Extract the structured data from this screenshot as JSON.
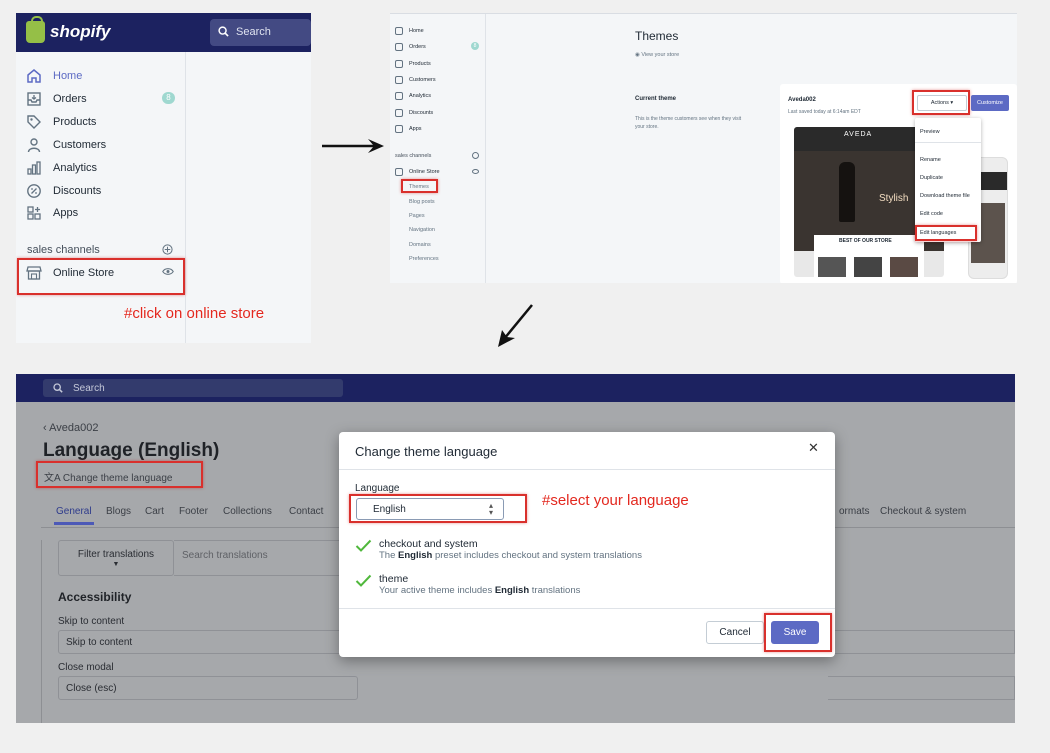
{
  "panel1": {
    "brand": "shopify",
    "search_placeholder": "Search",
    "nav": [
      {
        "label": "Home",
        "icon": "home-icon",
        "active": true
      },
      {
        "label": "Orders",
        "icon": "orders-icon",
        "badge": "8"
      },
      {
        "label": "Products",
        "icon": "tag-icon"
      },
      {
        "label": "Customers",
        "icon": "person-icon"
      },
      {
        "label": "Analytics",
        "icon": "bar-chart-icon"
      },
      {
        "label": "Discounts",
        "icon": "discount-icon"
      },
      {
        "label": "Apps",
        "icon": "apps-icon"
      }
    ],
    "sales_channels_label": "sales channels",
    "online_store_label": "Online Store",
    "annotation": "#click on online store"
  },
  "panel2": {
    "nav": [
      "Home",
      "Orders",
      "Products",
      "Customers",
      "Analytics",
      "Discounts",
      "Apps"
    ],
    "orders_badge": "8",
    "sales_channels_label": "sales channels",
    "online_store_label": "Online Store",
    "sub_items": [
      "Themes",
      "Blog posts",
      "Pages",
      "Navigation",
      "Domains",
      "Preferences"
    ],
    "title": "Themes",
    "view_store": "View your store",
    "current_theme_heading": "Current theme",
    "current_theme_desc": "This is the theme customers see when they visit your store.",
    "theme_name": "Aveda002",
    "last_saved": "Last saved today at 6:14am EDT",
    "actions_label": "Actions",
    "customize_label": "Customize",
    "actions_menu": [
      "Preview",
      "Rename",
      "Duplicate",
      "Download theme file",
      "Edit code",
      "Edit languages"
    ],
    "preview_brand": "AVEDA",
    "preview_headline": "Stylish",
    "preview_section": "BEST OF OUR STORE"
  },
  "panel3": {
    "search_placeholder": "Search",
    "breadcrumb": "Aveda002",
    "page_title": "Language (English)",
    "change_language_link": "Change theme language",
    "tabs": [
      "General",
      "Blogs",
      "Cart",
      "Footer",
      "Collections",
      "Contact"
    ],
    "tabs_right": [
      "ormats",
      "Checkout & system"
    ],
    "filter_button": "Filter translations",
    "search_translations_placeholder": "Search translations",
    "section_heading": "Accessibility",
    "fields": [
      {
        "label": "Skip to content",
        "value": "Skip to content"
      },
      {
        "label": "Close modal",
        "value": "Close (esc)"
      }
    ]
  },
  "modal": {
    "title": "Change theme language",
    "close_symbol": "✕",
    "language_label": "Language",
    "selected_language": "English",
    "annotation": "#select your language",
    "items": [
      {
        "title": "checkout and system",
        "desc_pre": "The ",
        "desc_bold": "English",
        "desc_post": " preset includes checkout and system translations"
      },
      {
        "title": "theme",
        "desc_pre": "Your active theme includes ",
        "desc_bold": "English",
        "desc_post": " translations"
      }
    ],
    "cancel_label": "Cancel",
    "save_label": "Save"
  },
  "colors": {
    "topbar": "#1c2260",
    "accent": "#5c6ac4",
    "annotation_red": "#e3281f",
    "check_green": "#50b83c"
  }
}
